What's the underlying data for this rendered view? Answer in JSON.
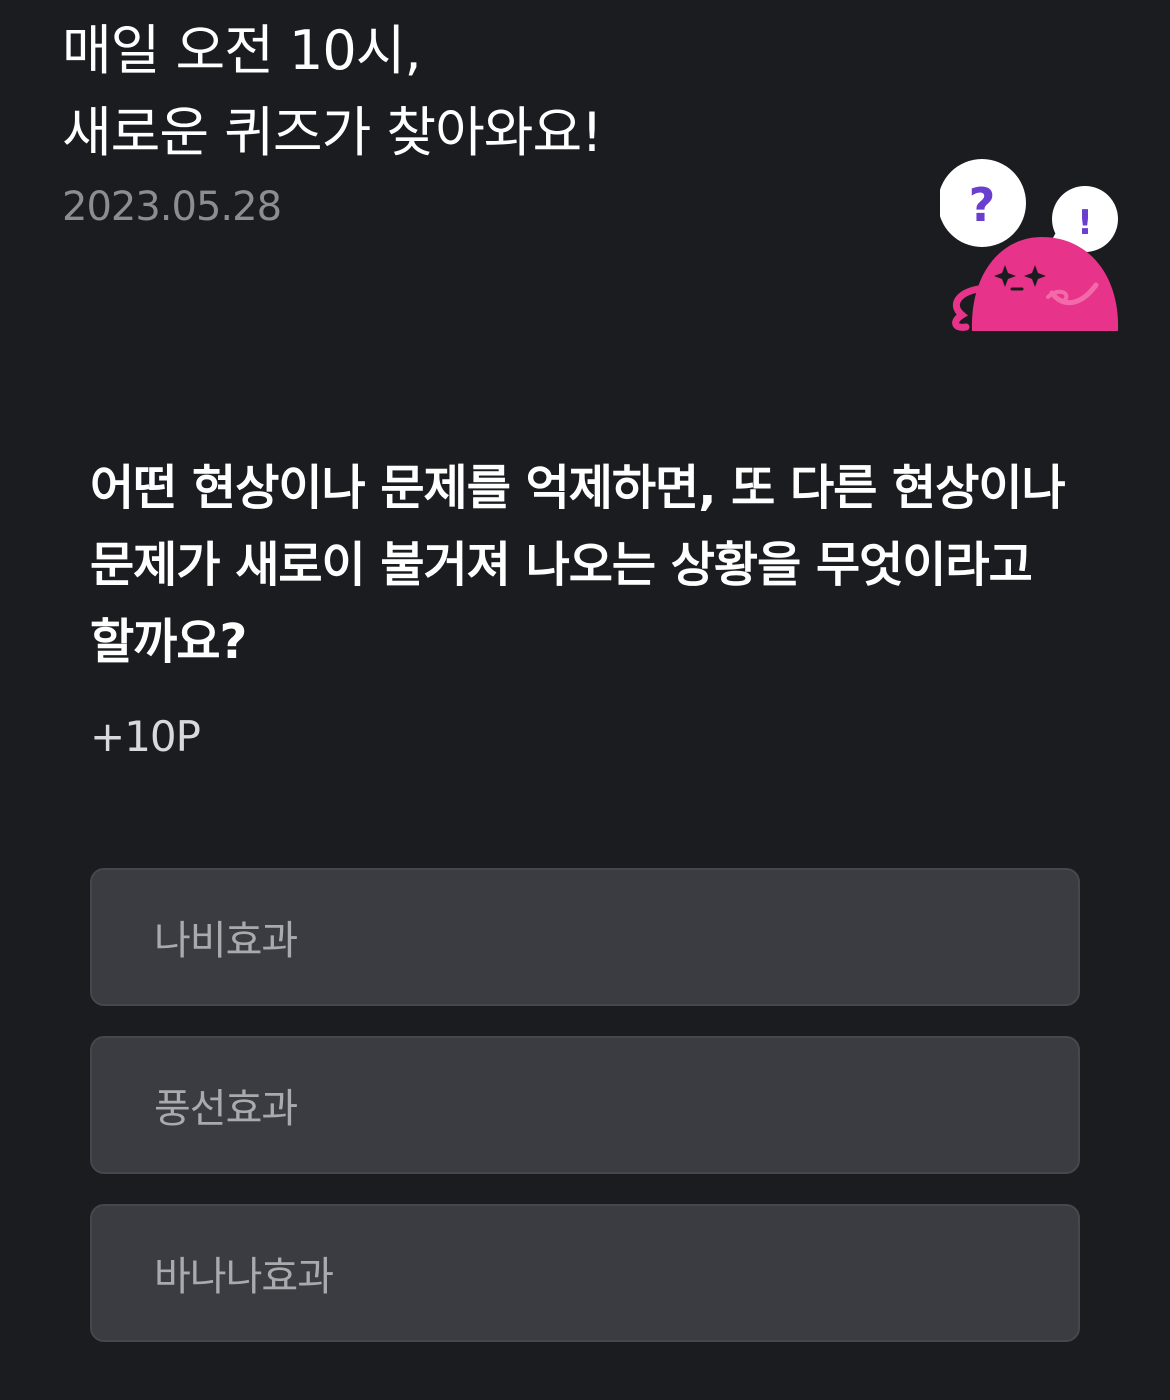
{
  "header": {
    "title_line1": "매일 오전 10시,",
    "title_line2": "새로운 퀴즈가 찾아와요!",
    "date": "2023.05.28"
  },
  "mascot": {
    "bubble_left_glyph": "?",
    "bubble_right_glyph": "!",
    "icon": "pink-blob-character-icon",
    "colors": {
      "body": "#e8338a",
      "question_mark": "#6a3fd0",
      "bubble": "#ffffff"
    }
  },
  "quiz": {
    "question": "어떤 현상이나 문제를 억제하면, 또 다른 현상이나 문제가 새로이 불거져 나오는 상황을 무엇이라고 할까요?",
    "points": "+10P",
    "options": [
      {
        "label": "나비효과"
      },
      {
        "label": "풍선효과"
      },
      {
        "label": "바나나효과"
      }
    ]
  },
  "colors": {
    "background": "#1b1c20",
    "option_background": "#3a3c41",
    "muted_text": "#8c8d92"
  }
}
